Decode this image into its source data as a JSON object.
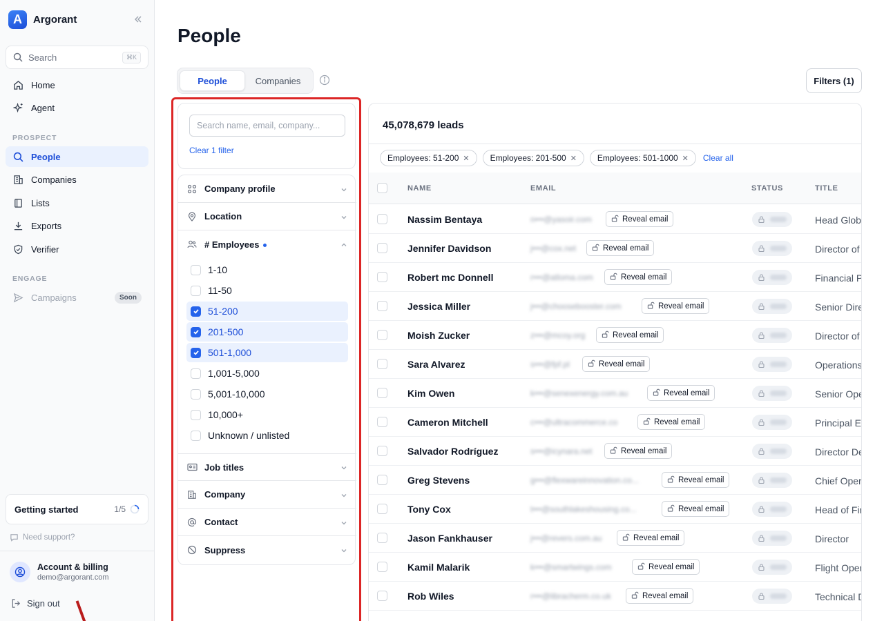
{
  "app": {
    "name": "Argorant"
  },
  "sidebar": {
    "search_label": "Search",
    "search_shortcut": "⌘K",
    "nav_top": [
      {
        "label": "Home",
        "icon": "home-icon"
      },
      {
        "label": "Agent",
        "icon": "sparkles-icon"
      }
    ],
    "prospect_label": "PROSPECT",
    "prospect": [
      {
        "label": "People",
        "icon": "search-icon",
        "active": true
      },
      {
        "label": "Companies",
        "icon": "building-icon"
      },
      {
        "label": "Lists",
        "icon": "book-icon"
      },
      {
        "label": "Exports",
        "icon": "download-icon"
      },
      {
        "label": "Verifier",
        "icon": "shield-icon"
      }
    ],
    "engage_label": "ENGAGE",
    "engage": [
      {
        "label": "Campaigns",
        "icon": "send-icon",
        "badge": "Soon",
        "disabled": true
      }
    ],
    "getting_started": {
      "label": "Getting started",
      "progress": "1/5"
    },
    "support": "Need support?",
    "account": {
      "title": "Account & billing",
      "email": "demo@argorant.com"
    },
    "signout": "Sign out"
  },
  "page": {
    "title": "People",
    "tabs": [
      {
        "label": "People",
        "active": true
      },
      {
        "label": "Companies"
      }
    ],
    "filters_button": "Filters (1)"
  },
  "filter_panel": {
    "search_placeholder": "Search name, email, company...",
    "clear_link": "Clear 1 filter",
    "sections": {
      "company_profile": "Company profile",
      "location": "Location",
      "employees": "# Employees",
      "job_titles": "Job titles",
      "company": "Company",
      "contact": "Contact",
      "suppress": "Suppress"
    },
    "employee_options": [
      {
        "label": "1-10",
        "checked": false
      },
      {
        "label": "11-50",
        "checked": false
      },
      {
        "label": "51-200",
        "checked": true
      },
      {
        "label": "201-500",
        "checked": true
      },
      {
        "label": "501-1,000",
        "checked": true
      },
      {
        "label": "1,001-5,000",
        "checked": false
      },
      {
        "label": "5,001-10,000",
        "checked": false
      },
      {
        "label": "10,000+",
        "checked": false
      },
      {
        "label": "Unknown / unlisted",
        "checked": false
      }
    ]
  },
  "leads": {
    "count": "45,078,679 leads",
    "chips": [
      "Employees: 51-200",
      "Employees: 201-500",
      "Employees: 501-1000"
    ],
    "clear_all": "Clear all",
    "columns": [
      "NAME",
      "EMAIL",
      "STATUS",
      "TITLE"
    ],
    "reveal_label": "Reveal email",
    "rows": [
      {
        "name": "Nassim Bentaya",
        "email": "n•••@yasoir.com",
        "title": "Head Globa"
      },
      {
        "name": "Jennifer Davidson",
        "email": "j•••@cox.net",
        "title": "Director of"
      },
      {
        "name": "Robert mc Donnell",
        "email": "r•••@atloma.com",
        "title": "Financial P"
      },
      {
        "name": "Jessica Miller",
        "email": "j•••@choosebooster.com",
        "title": "Senior Dire"
      },
      {
        "name": "Moish Zucker",
        "email": "z•••@mcoy.org",
        "title": "Director of"
      },
      {
        "name": "Sara Alvarez",
        "email": "s•••@fpf.pl",
        "title": "Operations"
      },
      {
        "name": "Kim Owen",
        "email": "k•••@senexenergy.com.au",
        "title": "Senior Ope"
      },
      {
        "name": "Cameron Mitchell",
        "email": "c•••@ultracommerce.co",
        "title": "Principal E"
      },
      {
        "name": "Salvador Rodríguez",
        "email": "s•••@icynara.net",
        "title": "Director De"
      },
      {
        "name": "Greg Stevens",
        "email": "g•••@flexwareinnovation.co...",
        "title": "Chief Oper"
      },
      {
        "name": "Tony Cox",
        "email": "t•••@southlakeshousing.co...",
        "title": "Head of Fir"
      },
      {
        "name": "Jason Fankhauser",
        "email": "j•••@revers.com.au",
        "title": "Director"
      },
      {
        "name": "Kamil Malarik",
        "email": "k•••@smartwings.com",
        "title": "Flight Oper"
      },
      {
        "name": "Rob Wiles",
        "email": "r•••@libracherm.co.uk",
        "title": "Technical D"
      }
    ]
  }
}
